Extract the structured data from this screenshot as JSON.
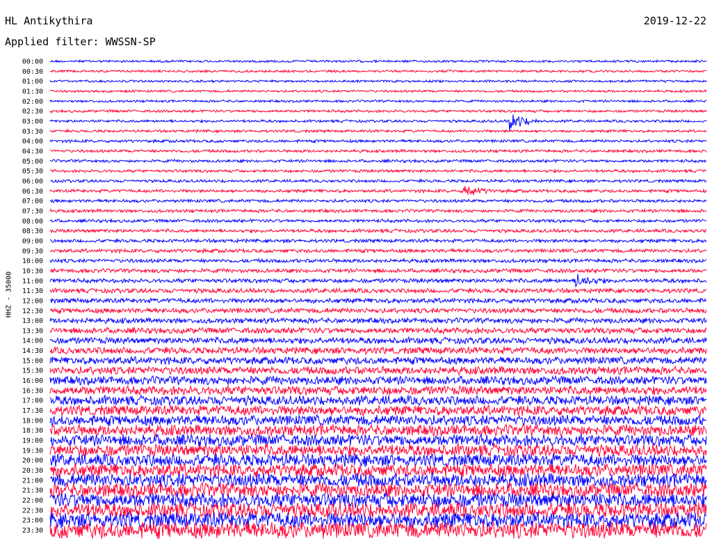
{
  "header": {
    "station": "HL Antikythira",
    "date": "2019-12-22",
    "filter_label": "Applied filter: WWSSN-SP"
  },
  "chart_data": {
    "type": "line",
    "title": "HL Antikythira",
    "ylabel": "HHZ - 35000",
    "row_labels": [
      "00:00",
      "00:30",
      "01:00",
      "01:30",
      "02:00",
      "02:30",
      "03:00",
      "03:30",
      "04:00",
      "04:30",
      "05:00",
      "05:30",
      "06:00",
      "06:30",
      "07:00",
      "07:30",
      "08:00",
      "08:30",
      "09:00",
      "09:30",
      "10:00",
      "10:30",
      "11:00",
      "11:30",
      "12:00",
      "12:30",
      "13:00",
      "13:30",
      "14:00",
      "14:30",
      "15:00",
      "15:30",
      "16:00",
      "16:30",
      "17:00",
      "17:30",
      "18:00",
      "18:30",
      "19:00",
      "19:30",
      "20:00",
      "20:30",
      "21:00",
      "21:30",
      "22:00",
      "22:30",
      "23:00",
      "23:30"
    ],
    "row_colors": [
      "#0000ff",
      "#ff0033"
    ],
    "amplitude_relative": [
      0.45,
      0.45,
      0.45,
      0.45,
      0.45,
      0.5,
      0.5,
      0.5,
      0.55,
      0.55,
      0.55,
      0.55,
      0.55,
      0.6,
      0.6,
      0.6,
      0.6,
      0.65,
      0.65,
      0.7,
      0.7,
      0.75,
      0.8,
      0.85,
      0.9,
      0.95,
      1.0,
      1.1,
      1.2,
      1.3,
      1.4,
      1.5,
      1.6,
      1.7,
      1.8,
      1.9,
      2.0,
      2.1,
      2.2,
      2.3,
      2.4,
      2.5,
      2.6,
      2.7,
      2.8,
      2.9,
      3.0,
      3.2
    ],
    "events": [
      {
        "row": 6,
        "x_fraction": 0.7,
        "amplitude_relative": 4.5
      },
      {
        "row": 13,
        "x_fraction": 0.63,
        "amplitude_relative": 3.0
      },
      {
        "row": 22,
        "x_fraction": 0.8,
        "amplitude_relative": 3.5
      }
    ]
  }
}
